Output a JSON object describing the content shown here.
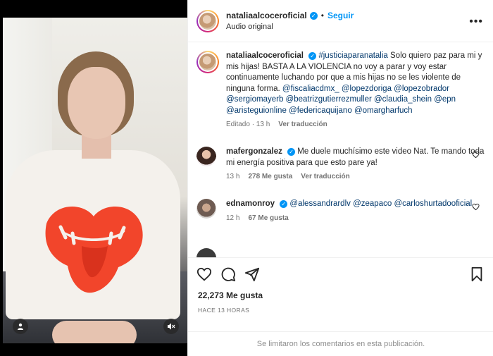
{
  "post": {
    "username": "nataliaalcoceroficial",
    "follow_label": "Seguir",
    "audio_label": "Audio original",
    "more_icon": "more-horizontal-icon"
  },
  "caption": {
    "username": "nataliaalcoceroficial",
    "text_parts": [
      {
        "type": "tag",
        "text": "#justiciaparanatalia"
      },
      {
        "type": "text",
        "text": " Solo quiero paz para mi y mis hijas! BASTA A LA VIOLENCIA no voy a parar y voy estar continuamente luchando por que a mis hijas no se les violente de ninguna forma. "
      },
      {
        "type": "tag",
        "text": "@fiscaliacdmx_"
      },
      {
        "type": "text",
        "text": " "
      },
      {
        "type": "tag",
        "text": "@lopezdoriga"
      },
      {
        "type": "text",
        "text": " "
      },
      {
        "type": "tag",
        "text": "@lopezobrador"
      },
      {
        "type": "text",
        "text": " "
      },
      {
        "type": "tag",
        "text": "@sergiomayerb"
      },
      {
        "type": "text",
        "text": " "
      },
      {
        "type": "tag",
        "text": "@beatrizgutierrezmuller"
      },
      {
        "type": "text",
        "text": " "
      },
      {
        "type": "tag",
        "text": "@claudia_shein"
      },
      {
        "type": "text",
        "text": " "
      },
      {
        "type": "tag",
        "text": "@epn"
      },
      {
        "type": "text",
        "text": " "
      },
      {
        "type": "tag",
        "text": "@aristeguionline"
      },
      {
        "type": "text",
        "text": " "
      },
      {
        "type": "tag",
        "text": "@federicaquijano"
      },
      {
        "type": "text",
        "text": " "
      },
      {
        "type": "tag",
        "text": "@omargharfuch"
      }
    ],
    "edited": "Editado · 13 h",
    "translate": "Ver traducción"
  },
  "comments": [
    {
      "username": "mafergonzalez",
      "text": "Me duele muchísimo este video Nat. Te mando toda mi energía positiva para que esto pare ya!",
      "time": "13 h",
      "likes": "278 Me gusta",
      "translate": "Ver traducción"
    },
    {
      "username": "ednamonroy",
      "tags": "@alessandrardlv @zeapaco @carloshurtadooficial",
      "tag1": "@alessandrardlv",
      "tag2": "@zeapaco",
      "tag3": "@carloshurtadooficial",
      "time": "12 h",
      "likes": "67 Me gusta"
    }
  ],
  "actions": {
    "likes": "22,273 Me gusta",
    "time_ago": "HACE 13 HORAS"
  },
  "footer": {
    "notice": "Se limitaron los comentarios en esta publicación."
  },
  "colors": {
    "link": "#00376b",
    "accent": "#0095f6",
    "muted": "#737373"
  }
}
